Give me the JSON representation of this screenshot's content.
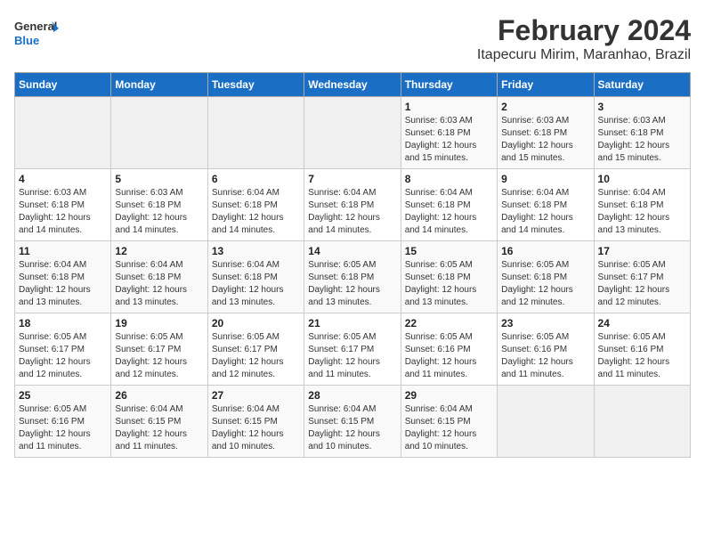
{
  "header": {
    "logo_line1": "General",
    "logo_line2": "Blue",
    "title": "February 2024",
    "subtitle": "Itapecuru Mirim, Maranhao, Brazil"
  },
  "days_of_week": [
    "Sunday",
    "Monday",
    "Tuesday",
    "Wednesday",
    "Thursday",
    "Friday",
    "Saturday"
  ],
  "weeks": [
    [
      {
        "day": "",
        "info": ""
      },
      {
        "day": "",
        "info": ""
      },
      {
        "day": "",
        "info": ""
      },
      {
        "day": "",
        "info": ""
      },
      {
        "day": "1",
        "info": "Sunrise: 6:03 AM\nSunset: 6:18 PM\nDaylight: 12 hours\nand 15 minutes."
      },
      {
        "day": "2",
        "info": "Sunrise: 6:03 AM\nSunset: 6:18 PM\nDaylight: 12 hours\nand 15 minutes."
      },
      {
        "day": "3",
        "info": "Sunrise: 6:03 AM\nSunset: 6:18 PM\nDaylight: 12 hours\nand 15 minutes."
      }
    ],
    [
      {
        "day": "4",
        "info": "Sunrise: 6:03 AM\nSunset: 6:18 PM\nDaylight: 12 hours\nand 14 minutes."
      },
      {
        "day": "5",
        "info": "Sunrise: 6:03 AM\nSunset: 6:18 PM\nDaylight: 12 hours\nand 14 minutes."
      },
      {
        "day": "6",
        "info": "Sunrise: 6:04 AM\nSunset: 6:18 PM\nDaylight: 12 hours\nand 14 minutes."
      },
      {
        "day": "7",
        "info": "Sunrise: 6:04 AM\nSunset: 6:18 PM\nDaylight: 12 hours\nand 14 minutes."
      },
      {
        "day": "8",
        "info": "Sunrise: 6:04 AM\nSunset: 6:18 PM\nDaylight: 12 hours\nand 14 minutes."
      },
      {
        "day": "9",
        "info": "Sunrise: 6:04 AM\nSunset: 6:18 PM\nDaylight: 12 hours\nand 14 minutes."
      },
      {
        "day": "10",
        "info": "Sunrise: 6:04 AM\nSunset: 6:18 PM\nDaylight: 12 hours\nand 13 minutes."
      }
    ],
    [
      {
        "day": "11",
        "info": "Sunrise: 6:04 AM\nSunset: 6:18 PM\nDaylight: 12 hours\nand 13 minutes."
      },
      {
        "day": "12",
        "info": "Sunrise: 6:04 AM\nSunset: 6:18 PM\nDaylight: 12 hours\nand 13 minutes."
      },
      {
        "day": "13",
        "info": "Sunrise: 6:04 AM\nSunset: 6:18 PM\nDaylight: 12 hours\nand 13 minutes."
      },
      {
        "day": "14",
        "info": "Sunrise: 6:05 AM\nSunset: 6:18 PM\nDaylight: 12 hours\nand 13 minutes."
      },
      {
        "day": "15",
        "info": "Sunrise: 6:05 AM\nSunset: 6:18 PM\nDaylight: 12 hours\nand 13 minutes."
      },
      {
        "day": "16",
        "info": "Sunrise: 6:05 AM\nSunset: 6:18 PM\nDaylight: 12 hours\nand 12 minutes."
      },
      {
        "day": "17",
        "info": "Sunrise: 6:05 AM\nSunset: 6:17 PM\nDaylight: 12 hours\nand 12 minutes."
      }
    ],
    [
      {
        "day": "18",
        "info": "Sunrise: 6:05 AM\nSunset: 6:17 PM\nDaylight: 12 hours\nand 12 minutes."
      },
      {
        "day": "19",
        "info": "Sunrise: 6:05 AM\nSunset: 6:17 PM\nDaylight: 12 hours\nand 12 minutes."
      },
      {
        "day": "20",
        "info": "Sunrise: 6:05 AM\nSunset: 6:17 PM\nDaylight: 12 hours\nand 12 minutes."
      },
      {
        "day": "21",
        "info": "Sunrise: 6:05 AM\nSunset: 6:17 PM\nDaylight: 12 hours\nand 11 minutes."
      },
      {
        "day": "22",
        "info": "Sunrise: 6:05 AM\nSunset: 6:16 PM\nDaylight: 12 hours\nand 11 minutes."
      },
      {
        "day": "23",
        "info": "Sunrise: 6:05 AM\nSunset: 6:16 PM\nDaylight: 12 hours\nand 11 minutes."
      },
      {
        "day": "24",
        "info": "Sunrise: 6:05 AM\nSunset: 6:16 PM\nDaylight: 12 hours\nand 11 minutes."
      }
    ],
    [
      {
        "day": "25",
        "info": "Sunrise: 6:05 AM\nSunset: 6:16 PM\nDaylight: 12 hours\nand 11 minutes."
      },
      {
        "day": "26",
        "info": "Sunrise: 6:04 AM\nSunset: 6:15 PM\nDaylight: 12 hours\nand 11 minutes."
      },
      {
        "day": "27",
        "info": "Sunrise: 6:04 AM\nSunset: 6:15 PM\nDaylight: 12 hours\nand 10 minutes."
      },
      {
        "day": "28",
        "info": "Sunrise: 6:04 AM\nSunset: 6:15 PM\nDaylight: 12 hours\nand 10 minutes."
      },
      {
        "day": "29",
        "info": "Sunrise: 6:04 AM\nSunset: 6:15 PM\nDaylight: 12 hours\nand 10 minutes."
      },
      {
        "day": "",
        "info": ""
      },
      {
        "day": "",
        "info": ""
      }
    ]
  ]
}
